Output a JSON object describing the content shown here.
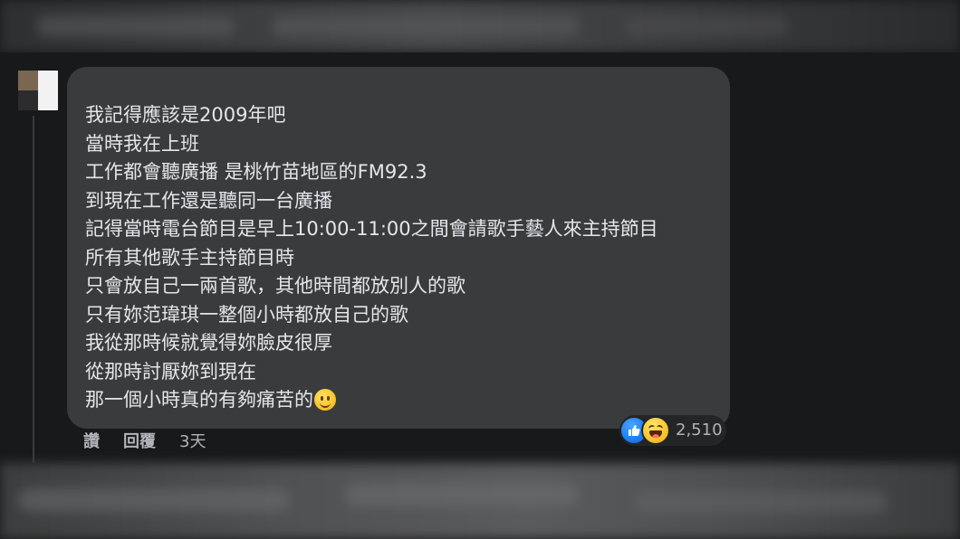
{
  "comment": {
    "lines": [
      "我記得應該是2009年吧",
      "當時我在上班",
      "工作都會聽廣播 是桃竹苗地區的FM92.3",
      "到現在工作還是聽同一台廣播",
      "記得當時電台節目是早上10:00-11:00之間會請歌手藝人來主持節目",
      "所有其他歌手主持節目時",
      "只會放自己一兩首歌，其他時間都放別人的歌",
      "只有妳范瑋琪一整個小時都放自己的歌",
      "我從那時候就覺得妳臉皮很厚",
      "從那時討厭妳到現在",
      "那一個小時真的有夠痛苦的"
    ],
    "trailing_emoji": "smiling-face-icon"
  },
  "reactions": {
    "icons": [
      "like-icon",
      "haha-icon"
    ],
    "count": "2,510"
  },
  "actions": {
    "like_label": "讚",
    "reply_label": "回覆",
    "timestamp": "3天"
  },
  "colors": {
    "background": "#18191a",
    "bubble": "#3a3b3c",
    "text": "#e4e6eb",
    "secondary_text": "#b0b3b8",
    "like_blue": "#1877f2",
    "haha_yellow": "#f7c52c"
  }
}
